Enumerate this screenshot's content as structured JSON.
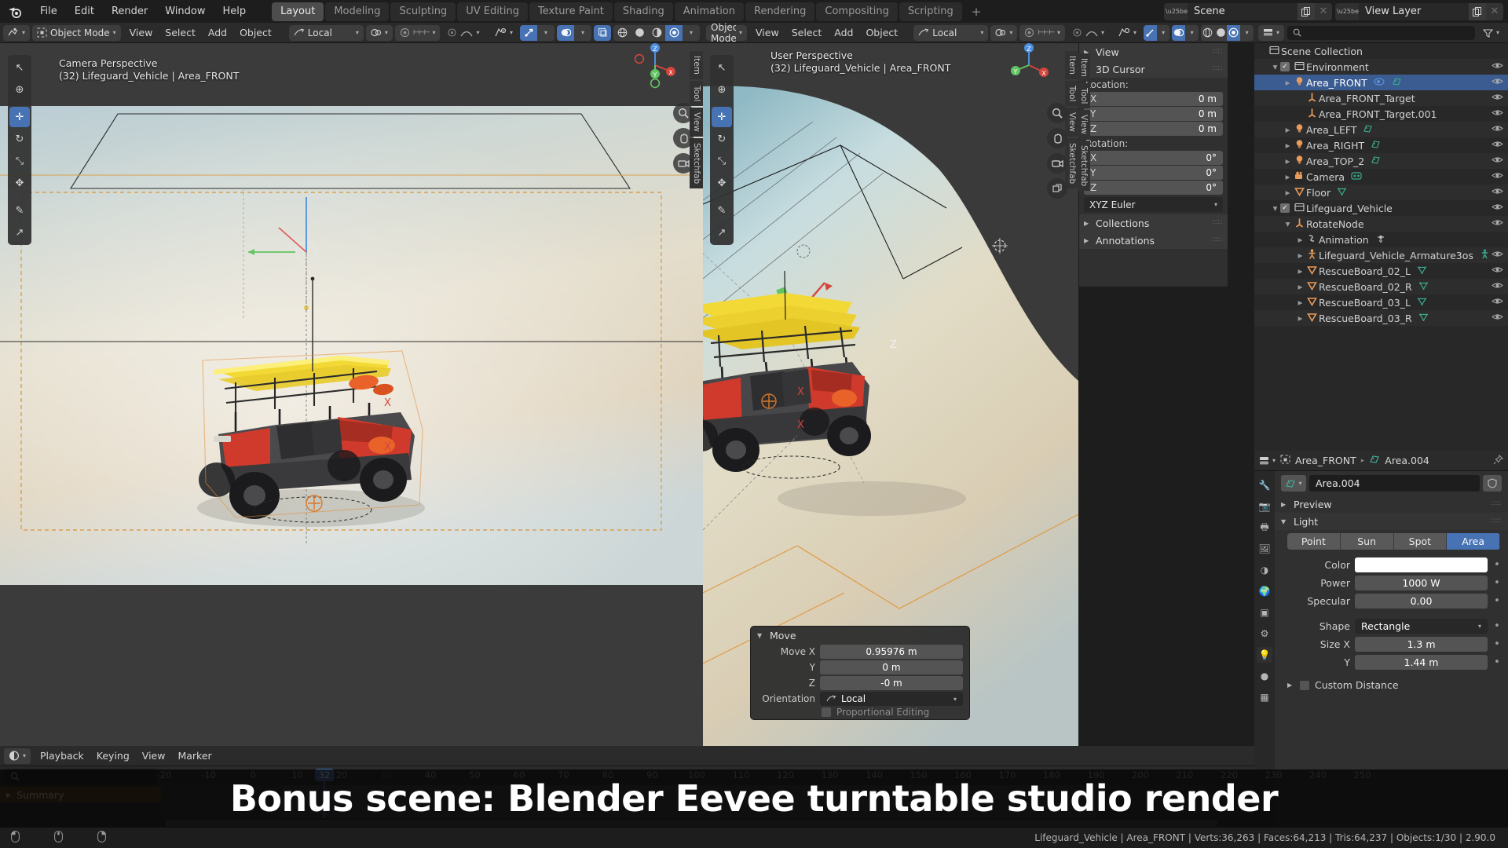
{
  "app": {
    "title": "Blender",
    "version": "2.90.0"
  },
  "topbar": {
    "logo_icon": "blender-logo-icon",
    "menus": [
      "File",
      "Edit",
      "Render",
      "Window",
      "Help"
    ],
    "workspaces": [
      {
        "label": "Layout",
        "active": true
      },
      {
        "label": "Modeling",
        "active": false
      },
      {
        "label": "Sculpting",
        "active": false
      },
      {
        "label": "UV Editing",
        "active": false
      },
      {
        "label": "Texture Paint",
        "active": false
      },
      {
        "label": "Shading",
        "active": false
      },
      {
        "label": "Animation",
        "active": false
      },
      {
        "label": "Rendering",
        "active": false
      },
      {
        "label": "Compositing",
        "active": false
      },
      {
        "label": "Scripting",
        "active": false
      }
    ],
    "add_workspace_label": "+",
    "scene_name": "Scene",
    "view_layer_name": "View Layer",
    "scene_icon": "scene-data-icon",
    "view_layer_icon": "view-layer-icon",
    "new_icon": "copy-new-icon",
    "remove_icon": "x-close-icon"
  },
  "viewport_left": {
    "header": {
      "mode": "Object Mode",
      "menus": [
        "View",
        "Select",
        "Add",
        "Object"
      ],
      "orientation": "Local",
      "editor_icon": "editor-type-icon",
      "mode_icon": "object-mode-icon",
      "snap_icon": "magnet-icon",
      "proportional_icon": "proportional-edit-icon",
      "shading_icons": [
        "wireframe-shading-icon",
        "solid-shading-icon",
        "material-preview-icon",
        "rendered-shading-icon"
      ],
      "overlay_icon": "overlays-icon",
      "gizmo_icon": "gizmo-icon",
      "xray_icon": "xray-toggle-icon",
      "visibility_icon": "visibility-icon"
    },
    "label_line1": "Camera Perspective",
    "label_line2": "(32) Lifeguard_Vehicle | Area_FRONT",
    "tools": [
      {
        "name": "tweak-tool",
        "glyph": "↖",
        "active": false
      },
      {
        "name": "cursor-tool",
        "glyph": "⊕",
        "active": false
      },
      {
        "name": "move-tool",
        "glyph": "✛",
        "active": true
      },
      {
        "name": "rotate-tool",
        "glyph": "↻",
        "active": false
      },
      {
        "name": "scale-tool",
        "glyph": "⤡",
        "active": false
      },
      {
        "name": "transform-tool",
        "glyph": "✥",
        "active": false
      },
      {
        "name": "annotate-tool",
        "glyph": "✎",
        "active": false
      },
      {
        "name": "measure-tool",
        "glyph": "↗",
        "active": false
      }
    ],
    "side_tabs": [
      "Item",
      "Tool",
      "View",
      "Sketchfab"
    ],
    "nav_buttons": [
      "zoom-navigate-icon",
      "pan-navigate-icon",
      "camera-view-icon"
    ]
  },
  "viewport_right": {
    "header": {
      "mode": "Object Mode",
      "menus": [
        "View",
        "Select",
        "Add",
        "Object"
      ],
      "orientation": "Local"
    },
    "label_line1": "User Perspective",
    "label_line2": "(32) Lifeguard_Vehicle | Area_FRONT",
    "side_tabs": [
      "Item",
      "Tool",
      "View",
      "Sketchfab"
    ],
    "nav_buttons": [
      "zoom-navigate-icon",
      "pan-navigate-icon",
      "camera-view-icon",
      "ortho-toggle-icon"
    ]
  },
  "npanel": {
    "tabs": [
      "Item",
      "Tool",
      "View",
      "Sketchfab"
    ],
    "sections": [
      {
        "label": "View",
        "expanded": false
      },
      {
        "label": "3D Cursor",
        "expanded": true
      },
      {
        "label": "Collections",
        "expanded": false
      },
      {
        "label": "Annotations",
        "expanded": false
      }
    ],
    "cursor": {
      "location_label": "Location:",
      "location": [
        {
          "axis": "X",
          "value": "0 m"
        },
        {
          "axis": "Y",
          "value": "0 m"
        },
        {
          "axis": "Z",
          "value": "0 m"
        }
      ],
      "rotation_label": "Rotation:",
      "rotation": [
        {
          "axis": "X",
          "value": "0°"
        },
        {
          "axis": "Y",
          "value": "0°"
        },
        {
          "axis": "Z",
          "value": "0°"
        }
      ],
      "rotation_mode": "XYZ Euler"
    }
  },
  "operator_panel": {
    "title": "Move",
    "rows": [
      {
        "label": "Move X",
        "value": "0.95976 m"
      },
      {
        "label": "Y",
        "value": "0 m"
      },
      {
        "label": "Z",
        "value": "-0 m"
      }
    ],
    "orientation_label": "Orientation",
    "orientation_value": "Local",
    "proportional_label": "Proportional Editing"
  },
  "outliner": {
    "display_mode_icon": "outliner-display-mode-icon",
    "filter_icon": "filter-funnel-icon",
    "search_placeholder": "",
    "search_icon": "search-icon",
    "root": "Scene Collection",
    "items": [
      {
        "label": "Scene Collection",
        "indent": 0,
        "icon": "collection-icon",
        "expand": "",
        "checkbox": false,
        "eye": false,
        "badges": [],
        "selected": false
      },
      {
        "label": "Environment",
        "indent": 1,
        "icon": "collection-icon",
        "expand": "▼",
        "checkbox": true,
        "eye": true,
        "badges": [],
        "selected": false
      },
      {
        "label": "Area_FRONT",
        "indent": 2,
        "icon": "light-icon",
        "expand": "▶",
        "checkbox": false,
        "eye": true,
        "badges": [
          "constraint-icon",
          "light-data-icon"
        ],
        "selected": true
      },
      {
        "label": "Area_FRONT_Target",
        "indent": 3,
        "icon": "empty-axes-icon",
        "expand": "",
        "checkbox": false,
        "eye": true,
        "badges": [],
        "selected": false
      },
      {
        "label": "Area_FRONT_Target.001",
        "indent": 3,
        "icon": "empty-axes-icon",
        "expand": "",
        "checkbox": false,
        "eye": true,
        "badges": [],
        "selected": false
      },
      {
        "label": "Area_LEFT",
        "indent": 2,
        "icon": "light-icon",
        "expand": "▶",
        "checkbox": false,
        "eye": true,
        "badges": [
          "light-data-icon"
        ],
        "selected": false
      },
      {
        "label": "Area_RIGHT",
        "indent": 2,
        "icon": "light-icon",
        "expand": "▶",
        "checkbox": false,
        "eye": true,
        "badges": [
          "light-data-icon"
        ],
        "selected": false
      },
      {
        "label": "Area_TOP_2",
        "indent": 2,
        "icon": "light-icon",
        "expand": "▶",
        "checkbox": false,
        "eye": true,
        "badges": [
          "light-data-icon"
        ],
        "selected": false
      },
      {
        "label": "Camera",
        "indent": 2,
        "icon": "camera-icon",
        "expand": "▶",
        "checkbox": false,
        "eye": true,
        "badges": [
          "camera-data-icon"
        ],
        "selected": false
      },
      {
        "label": "Floor",
        "indent": 2,
        "icon": "mesh-icon",
        "expand": "▶",
        "checkbox": false,
        "eye": true,
        "badges": [
          "mesh-data-icon"
        ],
        "selected": false
      },
      {
        "label": "Lifeguard_Vehicle",
        "indent": 1,
        "icon": "collection-icon",
        "expand": "▼",
        "checkbox": true,
        "eye": true,
        "badges": [],
        "selected": false
      },
      {
        "label": "RotateNode",
        "indent": 2,
        "icon": "empty-axes-icon",
        "expand": "▼",
        "checkbox": false,
        "eye": true,
        "badges": [],
        "selected": false
      },
      {
        "label": "Animation",
        "indent": 3,
        "icon": "animation-icon",
        "expand": "▶",
        "checkbox": false,
        "eye": false,
        "badges": [
          "action-icon"
        ],
        "selected": false
      },
      {
        "label": "Lifeguard_Vehicle_Armature3os",
        "indent": 3,
        "icon": "armature-icon",
        "expand": "▶",
        "checkbox": false,
        "eye": true,
        "badges": [
          "armature-data-icon"
        ],
        "selected": false
      },
      {
        "label": "RescueBoard_02_L",
        "indent": 3,
        "icon": "mesh-icon",
        "expand": "▶",
        "checkbox": false,
        "eye": true,
        "badges": [
          "mesh-data-icon"
        ],
        "selected": false
      },
      {
        "label": "RescueBoard_02_R",
        "indent": 3,
        "icon": "mesh-icon",
        "expand": "▶",
        "checkbox": false,
        "eye": true,
        "badges": [
          "mesh-data-icon"
        ],
        "selected": false
      },
      {
        "label": "RescueBoard_03_L",
        "indent": 3,
        "icon": "mesh-icon",
        "expand": "▶",
        "checkbox": false,
        "eye": true,
        "badges": [
          "mesh-data-icon"
        ],
        "selected": false
      },
      {
        "label": "RescueBoard_03_R",
        "indent": 3,
        "icon": "mesh-icon",
        "expand": "▶",
        "checkbox": false,
        "eye": true,
        "badges": [
          "mesh-data-icon"
        ],
        "selected": false
      }
    ]
  },
  "properties": {
    "breadcrumb_object": "Area_FRONT",
    "breadcrumb_data": "Area.004",
    "pin_icon": "pin-icon",
    "editor_icon": "properties-editor-icon",
    "datablock_name": "Area.004",
    "shield_icon": "fake-user-shield-icon",
    "tabs": [
      {
        "name": "tool-properties-tab",
        "glyph": "🔧",
        "active": false
      },
      {
        "name": "render-properties-tab",
        "glyph": "📷",
        "active": false
      },
      {
        "name": "output-properties-tab",
        "glyph": "🖶",
        "active": false
      },
      {
        "name": "view-layer-properties-tab",
        "glyph": "🖼",
        "active": false
      },
      {
        "name": "scene-properties-tab",
        "glyph": "◑",
        "active": false
      },
      {
        "name": "world-properties-tab",
        "glyph": "🌍",
        "active": false
      },
      {
        "name": "object-properties-tab",
        "glyph": "▣",
        "active": false
      },
      {
        "name": "modifier-properties-tab",
        "glyph": "⚙",
        "active": false
      },
      {
        "name": "object-data-properties-tab",
        "glyph": "💡",
        "active": true
      },
      {
        "name": "material-properties-tab",
        "glyph": "●",
        "active": false
      },
      {
        "name": "texture-properties-tab",
        "glyph": "▦",
        "active": false
      }
    ],
    "sections": [
      {
        "label": "Preview",
        "expanded": false
      },
      {
        "label": "Light",
        "expanded": true
      }
    ],
    "light_types": [
      {
        "label": "Point",
        "active": false
      },
      {
        "label": "Sun",
        "active": false
      },
      {
        "label": "Spot",
        "active": false
      },
      {
        "label": "Area",
        "active": true
      }
    ],
    "fields": [
      {
        "label": "Color",
        "value": "",
        "type": "color",
        "color": "#ffffff"
      },
      {
        "label": "Power",
        "value": "1000 W",
        "type": "value"
      },
      {
        "label": "Specular",
        "value": "0.00",
        "type": "value"
      },
      {
        "label": "Shape",
        "value": "Rectangle",
        "type": "dropdown"
      },
      {
        "label": "Size X",
        "value": "1.3 m",
        "type": "value"
      },
      {
        "label": "Y",
        "value": "1.44 m",
        "type": "value"
      }
    ],
    "custom_distance_label": "Custom Distance"
  },
  "timeline": {
    "editor_icon": "timeline-editor-icon",
    "menus": [
      "Playback",
      "Keying",
      "View",
      "Marker"
    ],
    "search_icon": "search-icon",
    "summary_label": "Summary",
    "current_frame": "32",
    "ticks": [
      "-20",
      "-10",
      "0",
      "10",
      "20",
      "30",
      "40",
      "50",
      "60",
      "70",
      "80",
      "90",
      "100",
      "110",
      "120",
      "130",
      "140",
      "150",
      "160",
      "170",
      "180",
      "190",
      "200",
      "210",
      "220",
      "230",
      "240",
      "250"
    ],
    "playback_icons": [
      "jump-start-icon",
      "prev-keyframe-icon",
      "play-reverse-icon",
      "play-icon",
      "next-keyframe-icon",
      "jump-end-icon"
    ]
  },
  "statusbar": {
    "mouse_icons": [
      "left-mouse-icon",
      "middle-mouse-icon",
      "right-mouse-icon"
    ],
    "info": "Lifeguard_Vehicle | Area_FRONT | Verts:36,263 | Faces:64,213 | Tris:64,237 | Objects:1/30 | 2.90.0"
  },
  "banner": {
    "text": "Bonus scene: Blender Eevee turntable studio render"
  },
  "colors": {
    "accent_blue": "#4772b3",
    "selection_orange": "#ed9e5c",
    "panel_bg": "#303030",
    "editor_bg": "#282828",
    "header_bg": "#2b2b2b",
    "window_bg": "#1d1d1d",
    "vehicle_red": "#c9352b",
    "board_yellow": "#f5dd3c"
  }
}
